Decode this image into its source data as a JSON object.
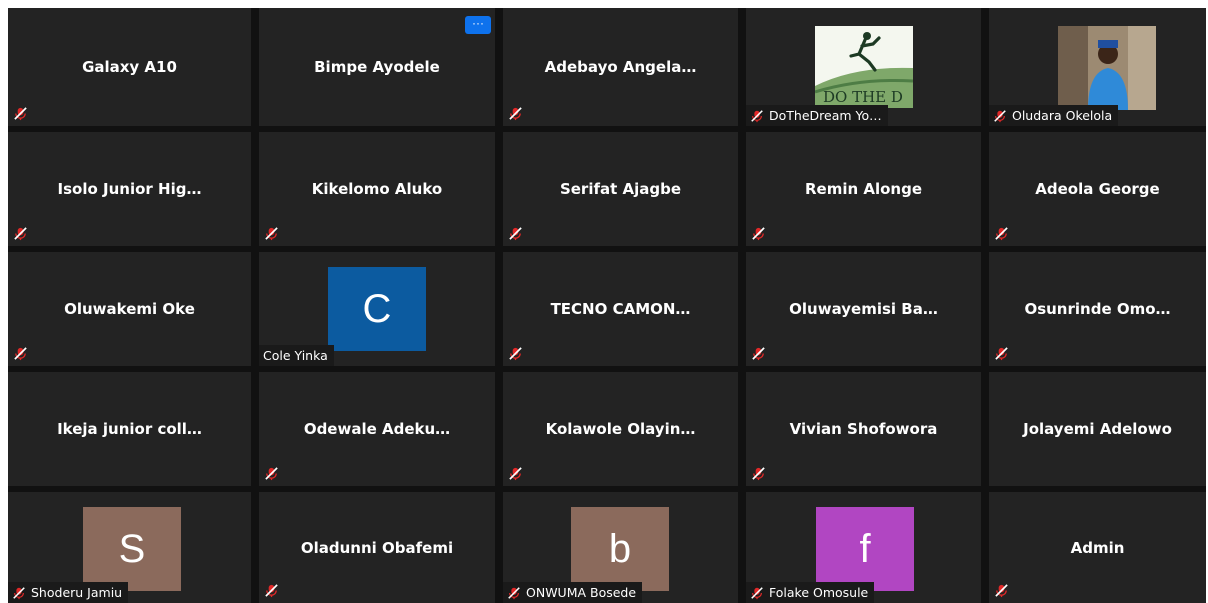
{
  "more_button_label": "···",
  "colors": {
    "background": "#111111",
    "tile": "#232323",
    "muted_icon": "#e02828",
    "more_button": "#0e72ed"
  },
  "participants": [
    {
      "name": "Galaxy A10",
      "muted": true
    },
    {
      "name": "Bimpe Ayodele",
      "muted": false
    },
    {
      "name": "Adebayo  Angela…",
      "muted": true
    },
    {
      "label": "DoTheDream Yo…",
      "muted": true,
      "video": "logo-image"
    },
    {
      "label": "Oludara Okelola",
      "muted": true,
      "video": "person-photo"
    },
    {
      "name": "Isolo Junior Hig…",
      "muted": true
    },
    {
      "name": "Kikelomo Aluko",
      "muted": true
    },
    {
      "name": "Serifat Ajagbe",
      "muted": true
    },
    {
      "name": "Remin Alonge",
      "muted": true
    },
    {
      "name": "Adeola George",
      "muted": true
    },
    {
      "name": "Oluwakemi Oke",
      "muted": true
    },
    {
      "label": "Cole Yinka",
      "muted": false,
      "avatar_letter": "C",
      "avatar_color": "#0c5ba0"
    },
    {
      "name": "TECNO  CAMON…",
      "muted": true
    },
    {
      "name": "Oluwayemisi  Ba…",
      "muted": true
    },
    {
      "name": "Osunrinde  Omo…",
      "muted": true
    },
    {
      "name": "Ikeja junior coll…",
      "muted": false
    },
    {
      "name": "Odewale  Adeku…",
      "muted": true
    },
    {
      "name": "Kolawole  Olayin…",
      "muted": true
    },
    {
      "name": "Vivian Shofowora",
      "muted": true
    },
    {
      "name": "Jolayemi Adelowo",
      "muted": false
    },
    {
      "label": "Shoderu Jamiu",
      "muted": true,
      "avatar_letter": "S",
      "avatar_color": "#8b6a5c"
    },
    {
      "name": "Oladunni Obafemi",
      "muted": true
    },
    {
      "label": "ONWUMA Bosede",
      "muted": true,
      "avatar_letter": "b",
      "avatar_color": "#8b6a5c"
    },
    {
      "label": "Folake Omosule",
      "muted": true,
      "avatar_letter": "f",
      "avatar_color": "#b146c2"
    },
    {
      "name": "Admin",
      "muted": true
    }
  ]
}
